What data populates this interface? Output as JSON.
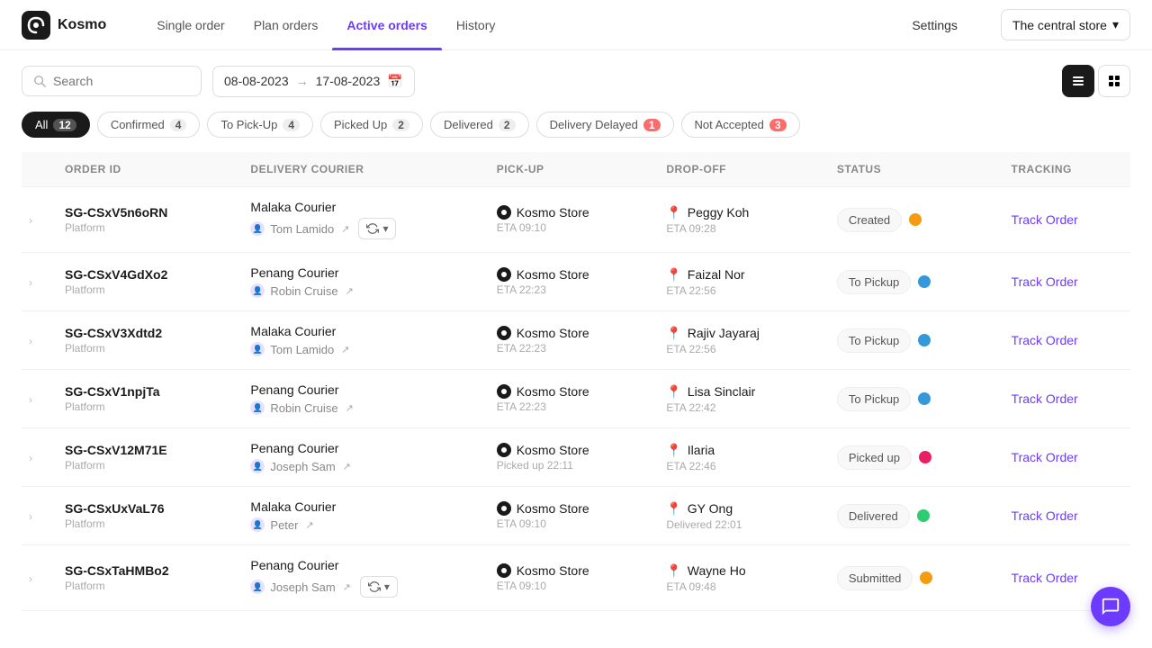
{
  "app": {
    "logo_text": "Kosmo",
    "nav": [
      {
        "label": "Single order",
        "active": false
      },
      {
        "label": "Plan orders",
        "active": false
      },
      {
        "label": "Active orders",
        "active": true
      },
      {
        "label": "History",
        "active": false
      }
    ],
    "settings_label": "Settings",
    "store_name": "The central store"
  },
  "toolbar": {
    "search_placeholder": "Search",
    "date_from": "08-08-2023",
    "date_to": "17-08-2023"
  },
  "filters": [
    {
      "label": "All",
      "count": "12",
      "active": true,
      "key": "all"
    },
    {
      "label": "Confirmed",
      "count": "4",
      "active": false,
      "key": "confirmed"
    },
    {
      "label": "To Pick-Up",
      "count": "4",
      "active": false,
      "key": "topickup"
    },
    {
      "label": "Picked Up",
      "count": "2",
      "active": false,
      "key": "pickedup"
    },
    {
      "label": "Delivered",
      "count": "2",
      "active": false,
      "key": "delivered"
    },
    {
      "label": "Delivery Delayed",
      "count": "1",
      "active": false,
      "key": "delayed",
      "alert": true
    },
    {
      "label": "Not Accepted",
      "count": "3",
      "active": false,
      "key": "notaccepted",
      "alert": true
    }
  ],
  "table": {
    "headers": [
      "ORDER ID",
      "DELIVERY COURIER",
      "PICK-UP",
      "DROP-OFF",
      "STATUS",
      "TRACKING"
    ],
    "rows": [
      {
        "id": "SG-CSxV5n6oRN",
        "type": "Platform",
        "courier": "Malaka Courier",
        "person": "Tom Lamido",
        "has_sync": true,
        "pickup_loc": "Kosmo Store",
        "pickup_eta": "ETA 09:10",
        "dropoff_name": "Peggy Koh",
        "dropoff_eta": "ETA 09:28",
        "status": "Created",
        "status_dot": "orange",
        "track_label": "Track Order"
      },
      {
        "id": "SG-CSxV4GdXo2",
        "type": "Platform",
        "courier": "Penang Courier",
        "person": "Robin Cruise",
        "has_sync": false,
        "pickup_loc": "Kosmo Store",
        "pickup_eta": "ETA 22:23",
        "dropoff_name": "Faizal Nor",
        "dropoff_eta": "ETA 22:56",
        "status": "To Pickup",
        "status_dot": "blue",
        "track_label": "Track Order"
      },
      {
        "id": "SG-CSxV3Xdtd2",
        "type": "Platform",
        "courier": "Malaka Courier",
        "person": "Tom Lamido",
        "has_sync": false,
        "pickup_loc": "Kosmo Store",
        "pickup_eta": "ETA 22:23",
        "dropoff_name": "Rajiv Jayaraj",
        "dropoff_eta": "ETA 22:56",
        "status": "To Pickup",
        "status_dot": "blue",
        "track_label": "Track Order"
      },
      {
        "id": "SG-CSxV1npjTa",
        "type": "Platform",
        "courier": "Penang Courier",
        "person": "Robin Cruise",
        "has_sync": false,
        "pickup_loc": "Kosmo Store",
        "pickup_eta": "ETA 22:23",
        "dropoff_name": "Lisa Sinclair",
        "dropoff_eta": "ETA 22:42",
        "status": "To Pickup",
        "status_dot": "blue",
        "track_label": "Track Order"
      },
      {
        "id": "SG-CSxV12M71E",
        "type": "Platform",
        "courier": "Penang Courier",
        "person": "Joseph Sam",
        "has_sync": false,
        "pickup_loc": "Kosmo Store",
        "pickup_eta": "Picked up 22:11",
        "dropoff_name": "Ilaria",
        "dropoff_eta": "ETA 22:46",
        "status": "Picked up",
        "status_dot": "pink",
        "track_label": "Track Order"
      },
      {
        "id": "SG-CSxUxVaL76",
        "type": "Platform",
        "courier": "Malaka Courier",
        "person": "Peter",
        "has_sync": false,
        "pickup_loc": "Kosmo Store",
        "pickup_eta": "ETA 09:10",
        "dropoff_name": "GY Ong",
        "dropoff_eta": "Delivered 22:01",
        "status": "Delivered",
        "status_dot": "green",
        "track_label": "Track Order"
      },
      {
        "id": "SG-CSxTaHMBo2",
        "type": "Platform",
        "courier": "Penang Courier",
        "person": "Joseph Sam",
        "has_sync": true,
        "pickup_loc": "Kosmo Store",
        "pickup_eta": "ETA 09:10",
        "dropoff_name": "Wayne Ho",
        "dropoff_eta": "ETA 09:48",
        "status": "Submitted",
        "status_dot": "orange",
        "track_label": "Track Order"
      }
    ]
  }
}
